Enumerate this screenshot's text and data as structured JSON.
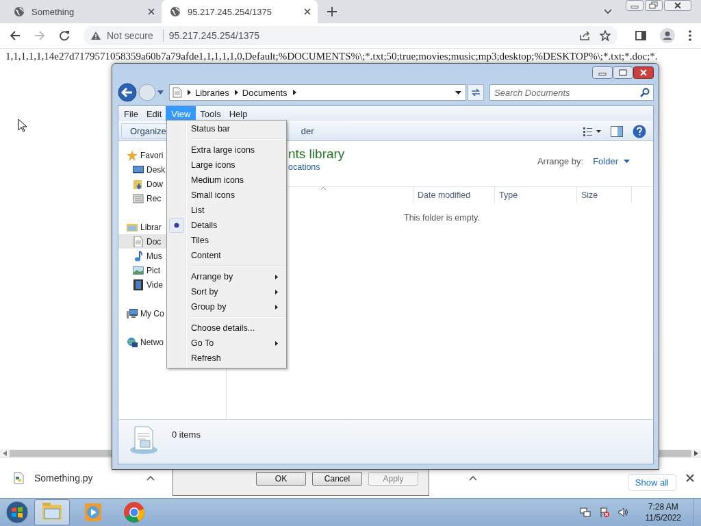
{
  "browser": {
    "tabs": [
      {
        "title": "Something",
        "selected": false
      },
      {
        "title": "95.217.245.254/1375",
        "selected": true
      }
    ],
    "security_label": "Not secure",
    "url": "95.217.245.254/1375"
  },
  "page": {
    "text": "1,1,1,1,1,14e27d7179571058359a60b7a79afde1,1,1,1,1,0,Default;%DOCUMENTS%\\;*.txt;50;true;movies;music;mp3;desktop;%DESKTOP%\\;*.txt;*.doc;*."
  },
  "explorer": {
    "breadcrumb": [
      "Libraries",
      "Documents"
    ],
    "search_placeholder": "Search Documents",
    "menu_bar": [
      {
        "label": "File",
        "selected": false
      },
      {
        "label": "Edit",
        "selected": false
      },
      {
        "label": "View",
        "selected": true
      },
      {
        "label": "Tools",
        "selected": false
      },
      {
        "label": "Help",
        "selected": false
      }
    ],
    "organize": "Organize",
    "command_partial": "der",
    "nav": [
      {
        "label": "Favori",
        "kind": "star",
        "selected": false,
        "children": [
          {
            "label": "Desk",
            "kind": "desktop",
            "selected": false
          },
          {
            "label": "Dow",
            "kind": "download",
            "selected": false
          },
          {
            "label": "Rec",
            "kind": "recent",
            "selected": false
          }
        ]
      },
      {
        "label": "Librar",
        "kind": "library",
        "selected": false,
        "children": [
          {
            "label": "Doc",
            "kind": "document",
            "selected": true
          },
          {
            "label": "Mus",
            "kind": "music",
            "selected": false
          },
          {
            "label": "Pict",
            "kind": "picture",
            "selected": false
          },
          {
            "label": "Vide",
            "kind": "video",
            "selected": false
          }
        ]
      },
      {
        "label": "My Co",
        "kind": "computer",
        "selected": false
      },
      {
        "label": "Netwo",
        "kind": "network",
        "selected": false
      }
    ],
    "heading": "nts library",
    "subheading": "ocations",
    "arrange_label": "Arrange by:",
    "arrange_value": "Folder",
    "columns": [
      "Date modified",
      "Type",
      "Size"
    ],
    "empty_text": "This folder is empty.",
    "status": "0 items"
  },
  "view_menu": [
    [
      {
        "label": "Status bar",
        "selected": false,
        "submenu": false
      }
    ],
    [
      {
        "label": "Extra large icons",
        "selected": false,
        "submenu": false
      },
      {
        "label": "Large icons",
        "selected": false,
        "submenu": false
      },
      {
        "label": "Medium icons",
        "selected": false,
        "submenu": false
      },
      {
        "label": "Small icons",
        "selected": false,
        "submenu": false
      },
      {
        "label": "List",
        "selected": false,
        "submenu": false
      },
      {
        "label": "Details",
        "selected": true,
        "submenu": false
      },
      {
        "label": "Tiles",
        "selected": false,
        "submenu": false
      },
      {
        "label": "Content",
        "selected": false,
        "submenu": false
      }
    ],
    [
      {
        "label": "Arrange by",
        "selected": false,
        "submenu": true
      },
      {
        "label": "Sort by",
        "selected": false,
        "submenu": true
      },
      {
        "label": "Group by",
        "selected": false,
        "submenu": true
      }
    ],
    [
      {
        "label": "Choose details...",
        "selected": false,
        "submenu": false
      },
      {
        "label": "Go To",
        "selected": false,
        "submenu": true
      },
      {
        "label": "Refresh",
        "selected": false,
        "submenu": false
      }
    ]
  ],
  "dialog": {
    "buttons": [
      {
        "label": "OK",
        "disabled": false
      },
      {
        "label": "Cancel",
        "disabled": false
      },
      {
        "label": "Apply",
        "disabled": true
      }
    ]
  },
  "downloads": {
    "file": "Something.py",
    "show_all": "Show all"
  },
  "taskbar": {
    "apps": [
      {
        "kind": "explorer",
        "selected": true
      },
      {
        "kind": "media",
        "selected": false
      },
      {
        "kind": "chrome",
        "selected": false
      }
    ],
    "time": "7:28 AM",
    "date": "11/5/2022"
  }
}
